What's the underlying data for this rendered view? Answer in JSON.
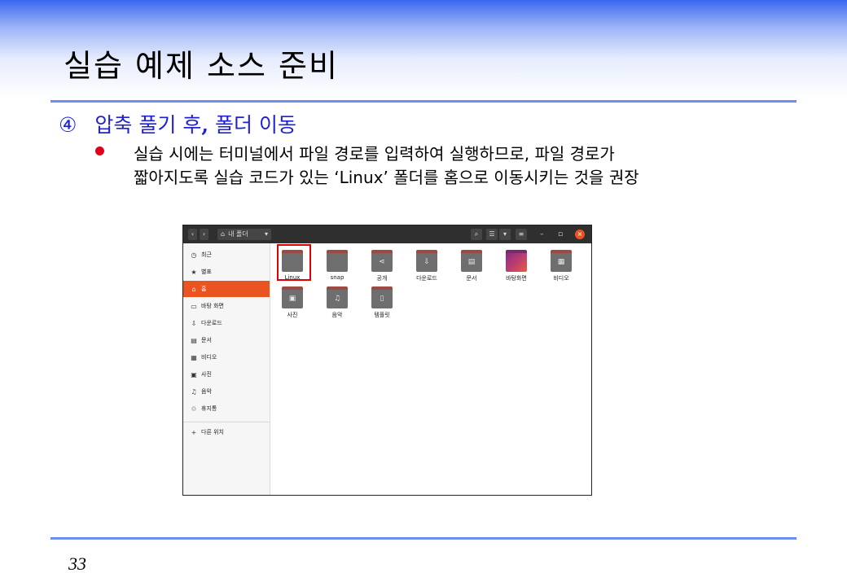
{
  "slide": {
    "title": "실습 예제 소스 준비",
    "subtitle_num": "④",
    "subtitle_a": "압축 풀기 후",
    "subtitle_comma": ",",
    "subtitle_b": " 폴더 이동",
    "bullet_line1": "실습 시에는 터미널에서 파일 경로를 입력하여 실행하므로, 파일 경로가",
    "bullet_line2": "짧아지도록 실습 코드가 있는 ‘Linux’ 폴더를 홈으로 이동시키는 것을 권장",
    "page_number": "33"
  },
  "window": {
    "path_label": "내 폴더",
    "sidebar": [
      {
        "label": "최근",
        "icon": "clock-icon",
        "glyph": "◷"
      },
      {
        "label": "별표",
        "icon": "star-icon",
        "glyph": "★"
      },
      {
        "label": "홈",
        "icon": "home-icon",
        "glyph": "⌂"
      },
      {
        "label": "바탕 화면",
        "icon": "desktop-icon",
        "glyph": "▭"
      },
      {
        "label": "다운로드",
        "icon": "download-icon",
        "glyph": "⇩"
      },
      {
        "label": "문서",
        "icon": "document-icon",
        "glyph": "▤"
      },
      {
        "label": "비디오",
        "icon": "video-icon",
        "glyph": "▦"
      },
      {
        "label": "사진",
        "icon": "picture-icon",
        "glyph": "▣"
      },
      {
        "label": "음악",
        "icon": "music-icon",
        "glyph": "♫"
      },
      {
        "label": "휴지통",
        "icon": "trash-icon",
        "glyph": "♲"
      }
    ],
    "other_locations": "다른 위치",
    "files": [
      {
        "label": "Linux",
        "icon": "folder-icon",
        "glyph": ""
      },
      {
        "label": "snap",
        "icon": "folder-icon",
        "glyph": ""
      },
      {
        "label": "공개",
        "icon": "share-folder-icon",
        "glyph": "⋖"
      },
      {
        "label": "다운로드",
        "icon": "download-folder-icon",
        "glyph": "⇩"
      },
      {
        "label": "문서",
        "icon": "document-folder-icon",
        "glyph": "▤"
      },
      {
        "label": "바탕화면",
        "icon": "desktop-folder-icon",
        "glyph": ""
      },
      {
        "label": "비디오",
        "icon": "video-folder-icon",
        "glyph": "▦"
      },
      {
        "label": "사진",
        "icon": "picture-folder-icon",
        "glyph": "▣"
      },
      {
        "label": "음악",
        "icon": "music-folder-icon",
        "glyph": "♫"
      },
      {
        "label": "템플릿",
        "icon": "template-folder-icon",
        "glyph": "▯"
      }
    ],
    "colors": {
      "accent": "#e95420",
      "highlight_box": "#e00000",
      "titlebar": "#2f2f2f"
    }
  }
}
